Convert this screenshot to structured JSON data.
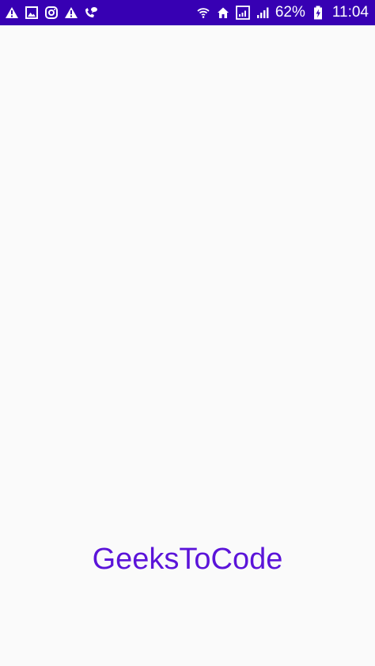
{
  "status_bar": {
    "background_color": "#3700b3",
    "left_icons": [
      "warning-icon",
      "image-icon",
      "instagram-icon",
      "warning-icon",
      "call-chat-icon"
    ],
    "right_icons": [
      "wifi-icon",
      "home-icon",
      "signal-box-icon",
      "cellular-signal-icon",
      "battery-charging-icon"
    ],
    "battery_percent": "62%",
    "time": "11:04"
  },
  "main": {
    "background_color": "#fafafa",
    "brand_text": "GeeksToCode",
    "brand_color": "#5b14d9"
  }
}
